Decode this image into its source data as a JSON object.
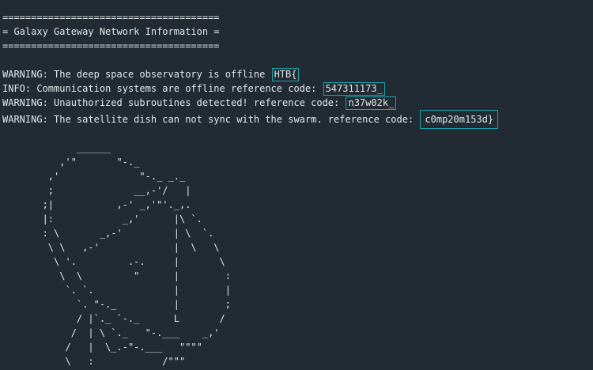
{
  "terminal": {
    "separator_top": "======================================",
    "title": "= Galaxy Gateway Network Information =",
    "separator_bottom": "======================================",
    "messages": [
      {
        "text": "WARNING: The deep space observatory is offline ",
        "code": "HTB{"
      },
      {
        "text": "INFO: Communication systems are offline reference code: ",
        "code": "547311173_"
      },
      {
        "text": "WARNING: Unauthorized subroutines detected! reference code: ",
        "code": "n37w02k_"
      },
      {
        "text": "WARNING: The satellite dish can not sync with the swarm. reference code: ",
        "code": "c0mp20m153d}"
      }
    ],
    "ascii_art": "             ______\n          ,'\"       \"-._\n        ,'              \"-._ _._\n        ;              __,-'/   |\n       ;|           ,-' _,'\"'._,.\n       |:            _,'      |\\ `.\n       : \\       _,-'         | \\  `.\n        \\ \\   ,-'             |  \\   \\\n         \\ '.         .-.     |       \\\n          \\  \\         \"      |        :\n           `. `.              |        |\n             `. \"-._          |        ;\n             / |`._ `-._      L       /\n            /  | \\ `._   \"-.___    _,'\n           /   |  \\_.-\"-.___   \"\"\"\"\n           \\   :            /\"\"\""
  },
  "colors": {
    "background": "#222b34",
    "text": "#e3e7ea",
    "highlight_box": "#1aa3b0"
  }
}
